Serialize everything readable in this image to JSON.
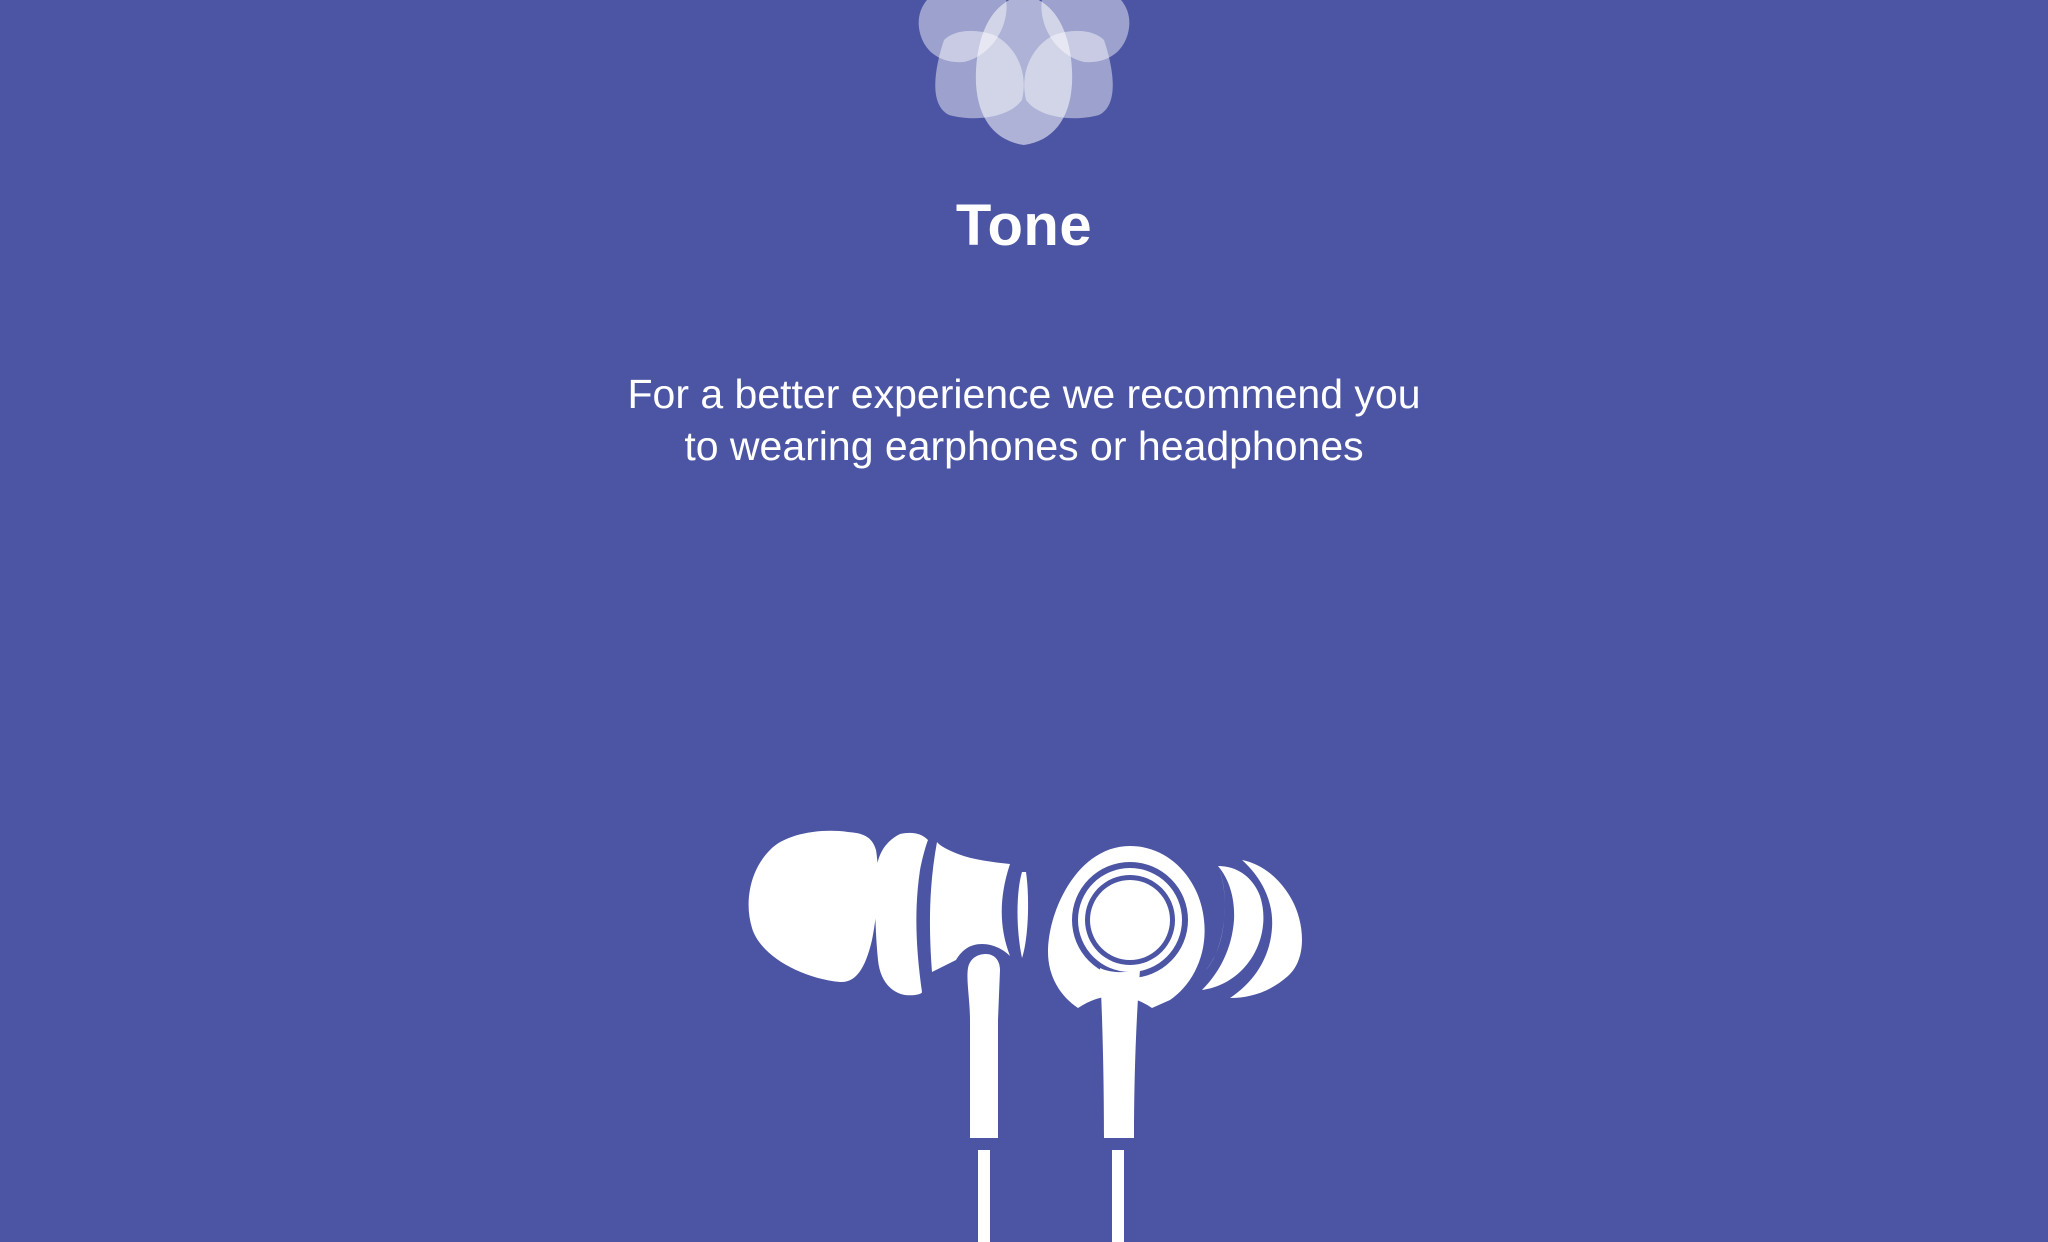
{
  "screen": {
    "background_color": "#4B55A4",
    "accent_color": "#FFFFFF"
  },
  "logo": {
    "icon": "tone-flower-logo-icon"
  },
  "title": "Tone",
  "message": "For a better experience we recommend you to wearing earphones or headphones",
  "illustration": {
    "icon": "earphones-icon"
  }
}
